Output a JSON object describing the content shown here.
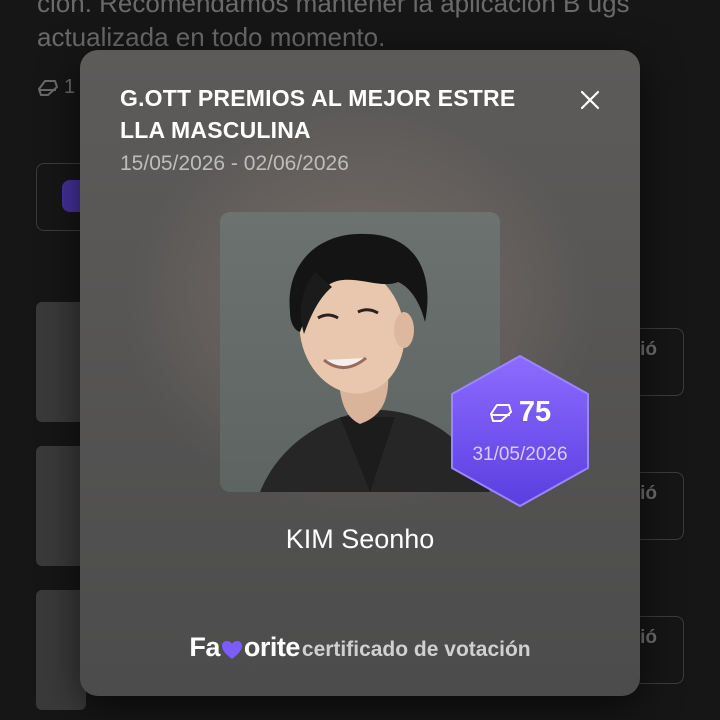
{
  "background": {
    "description_text": "ción. Recomendamos mantener la aplicación B ugs actualizada en todo momento.",
    "votes_prefix": "1",
    "row_button_label": "ació"
  },
  "modal": {
    "title": "G.OTT PREMIOS AL MEJOR ESTRE LLA MASCULINA",
    "date_range": "15/05/2026 - 02/06/2026",
    "close_icon": "close-icon",
    "candidate": {
      "name": "KIM Seonho"
    },
    "badge": {
      "votes": "75",
      "date": "31/05/2026",
      "icon": "eraser-vote-icon",
      "color": "#6a4cf0"
    },
    "footer": {
      "logo_before": "Fa",
      "logo_after": "orite",
      "logo_heart_color": "#7b5cff",
      "caption": "certificado de votación"
    }
  }
}
